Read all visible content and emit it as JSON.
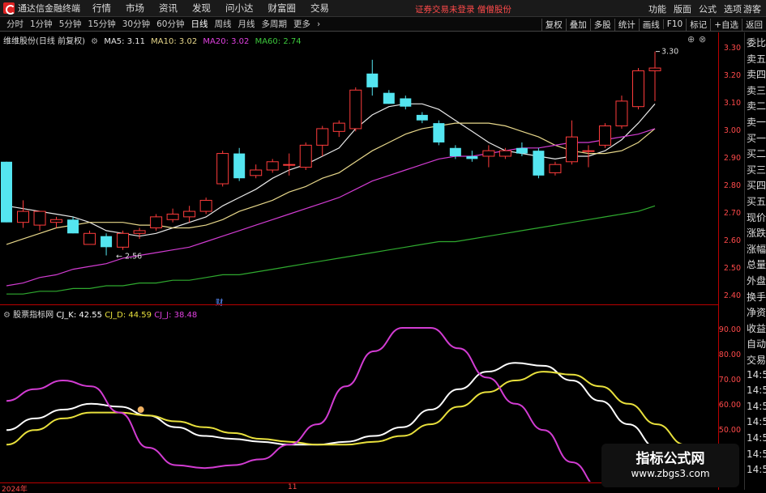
{
  "menubar": {
    "app_title": "通达信金融终端",
    "items": [
      "行情",
      "市场",
      "资讯",
      "发现",
      "问小达",
      "财富圈",
      "交易"
    ],
    "notice": "证券交易未登录  僧僧股份",
    "right_items": [
      "功能",
      "版面",
      "公式",
      "选项"
    ],
    "guest": "游客"
  },
  "toolbar": {
    "periods": [
      "分时",
      "1分钟",
      "5分钟",
      "15分钟",
      "30分钟",
      "60分钟",
      "日线",
      "周线",
      "月线",
      "多周期",
      "更多"
    ],
    "active_period": "日线",
    "right_items": [
      "复权",
      "叠加",
      "多股",
      "统计",
      "画线",
      "F10",
      "标记",
      "+自选",
      "返回"
    ]
  },
  "main_chart": {
    "stock_label": "维维股份(日线 前复权)",
    "ma": [
      {
        "name": "MA5: 3.11",
        "color": "#e8e8e8"
      },
      {
        "name": "MA10: 3.02",
        "color": "#e7d78a"
      },
      {
        "name": "MA20: 3.02",
        "color": "#e040e0"
      },
      {
        "name": "MA60: 2.74",
        "color": "#3cc83c"
      }
    ],
    "high_label": "3.30",
    "low_label": "2.56",
    "cai_label": "财",
    "y_ticks": [
      "3.30",
      "3.20",
      "3.10",
      "3.00",
      "2.90",
      "2.80",
      "2.70",
      "2.60",
      "2.50",
      "2.40"
    ]
  },
  "sub_chart": {
    "indicator_label": "股票指标网",
    "lines": [
      {
        "name": "CJ_K: 42.55",
        "color": "#ffffff"
      },
      {
        "name": "CJ_D: 44.59",
        "color": "#e8e03c"
      },
      {
        "name": "CJ_J: 38.48",
        "color": "#e040e0"
      }
    ],
    "y_ticks": [
      "90.00",
      "80.00",
      "70.00",
      "60.00",
      "50.00"
    ]
  },
  "xaxis": {
    "labels": [
      "2024年",
      "11"
    ]
  },
  "side_panel": {
    "items": [
      "委比",
      "卖五",
      "卖四",
      "卖三",
      "卖二",
      "卖一",
      "买一",
      "买二",
      "买三",
      "买四",
      "买五",
      "现价",
      "涨跌",
      "涨幅",
      "总量",
      "外盘",
      "换手",
      "净资",
      "收益",
      "自动",
      "交易",
      "14:5",
      "14:5",
      "14:5",
      "14:5",
      "14:5",
      "14:5",
      "14:5"
    ]
  },
  "watermark": {
    "line1": "指标公式网",
    "line2": "www.zbgs3.com"
  },
  "chart_data": [
    {
      "type": "candlestick",
      "ylim": [
        2.4,
        3.34
      ],
      "candles": [
        {
          "o": 2.9,
          "h": 2.9,
          "l": 2.68,
          "c": 2.68
        },
        {
          "o": 2.68,
          "h": 2.76,
          "l": 2.66,
          "c": 2.72
        },
        {
          "o": 2.67,
          "h": 2.72,
          "l": 2.65,
          "c": 2.72
        },
        {
          "o": 2.68,
          "h": 2.7,
          "l": 2.66,
          "c": 2.69
        },
        {
          "o": 2.69,
          "h": 2.7,
          "l": 2.64,
          "c": 2.64
        },
        {
          "o": 2.6,
          "h": 2.65,
          "l": 2.6,
          "c": 2.64
        },
        {
          "o": 2.63,
          "h": 2.64,
          "l": 2.56,
          "c": 2.59
        },
        {
          "o": 2.59,
          "h": 2.65,
          "l": 2.58,
          "c": 2.64
        },
        {
          "o": 2.64,
          "h": 2.66,
          "l": 2.62,
          "c": 2.65
        },
        {
          "o": 2.66,
          "h": 2.71,
          "l": 2.65,
          "c": 2.7
        },
        {
          "o": 2.69,
          "h": 2.73,
          "l": 2.68,
          "c": 2.71
        },
        {
          "o": 2.7,
          "h": 2.74,
          "l": 2.68,
          "c": 2.72
        },
        {
          "o": 2.72,
          "h": 2.77,
          "l": 2.71,
          "c": 2.76
        },
        {
          "o": 2.82,
          "h": 2.94,
          "l": 2.81,
          "c": 2.93
        },
        {
          "o": 2.93,
          "h": 2.95,
          "l": 2.83,
          "c": 2.84
        },
        {
          "o": 2.85,
          "h": 2.89,
          "l": 2.84,
          "c": 2.87
        },
        {
          "o": 2.87,
          "h": 2.91,
          "l": 2.86,
          "c": 2.9
        },
        {
          "o": 2.89,
          "h": 2.93,
          "l": 2.85,
          "c": 2.89
        },
        {
          "o": 2.88,
          "h": 2.97,
          "l": 2.87,
          "c": 2.96
        },
        {
          "o": 2.96,
          "h": 3.03,
          "l": 2.92,
          "c": 3.02
        },
        {
          "o": 3.01,
          "h": 3.05,
          "l": 2.99,
          "c": 3.04
        },
        {
          "o": 3.02,
          "h": 3.17,
          "l": 3.01,
          "c": 3.16
        },
        {
          "o": 3.22,
          "h": 3.27,
          "l": 3.14,
          "c": 3.17
        },
        {
          "o": 3.15,
          "h": 3.16,
          "l": 3.11,
          "c": 3.11
        },
        {
          "o": 3.13,
          "h": 3.14,
          "l": 3.09,
          "c": 3.1
        },
        {
          "o": 3.07,
          "h": 3.08,
          "l": 3.04,
          "c": 3.05
        },
        {
          "o": 3.04,
          "h": 3.05,
          "l": 2.96,
          "c": 2.97
        },
        {
          "o": 2.95,
          "h": 2.96,
          "l": 2.91,
          "c": 2.92
        },
        {
          "o": 2.92,
          "h": 2.94,
          "l": 2.9,
          "c": 2.91
        },
        {
          "o": 2.92,
          "h": 2.96,
          "l": 2.88,
          "c": 2.94
        },
        {
          "o": 2.92,
          "h": 2.95,
          "l": 2.91,
          "c": 2.94
        },
        {
          "o": 2.95,
          "h": 2.97,
          "l": 2.92,
          "c": 2.93
        },
        {
          "o": 2.94,
          "h": 2.95,
          "l": 2.84,
          "c": 2.85
        },
        {
          "o": 2.86,
          "h": 2.9,
          "l": 2.85,
          "c": 2.89
        },
        {
          "o": 2.9,
          "h": 3.05,
          "l": 2.89,
          "c": 2.99
        },
        {
          "o": 2.94,
          "h": 2.96,
          "l": 2.88,
          "c": 2.94
        },
        {
          "o": 2.96,
          "h": 3.04,
          "l": 2.95,
          "c": 3.03
        },
        {
          "o": 3.03,
          "h": 3.14,
          "l": 3.02,
          "c": 3.12
        },
        {
          "o": 3.1,
          "h": 3.24,
          "l": 3.09,
          "c": 3.23
        },
        {
          "o": 3.23,
          "h": 3.3,
          "l": 3.12,
          "c": 3.24
        }
      ],
      "series": [
        {
          "name": "MA5",
          "values": [
            2.74,
            2.73,
            2.72,
            2.71,
            2.7,
            2.68,
            2.65,
            2.64,
            2.63,
            2.64,
            2.66,
            2.68,
            2.7,
            2.74,
            2.77,
            2.8,
            2.84,
            2.87,
            2.89,
            2.92,
            2.95,
            3.02,
            3.07,
            3.1,
            3.11,
            3.11,
            3.09,
            3.05,
            3.01,
            2.97,
            2.94,
            2.93,
            2.92,
            2.91,
            2.92,
            2.92,
            2.94,
            2.98,
            3.04,
            3.11
          ]
        },
        {
          "name": "MA10",
          "values": [
            2.6,
            2.62,
            2.64,
            2.66,
            2.67,
            2.68,
            2.68,
            2.68,
            2.67,
            2.67,
            2.66,
            2.66,
            2.67,
            2.69,
            2.72,
            2.74,
            2.76,
            2.79,
            2.81,
            2.84,
            2.86,
            2.9,
            2.94,
            2.97,
            3.0,
            3.02,
            3.03,
            3.04,
            3.04,
            3.04,
            3.03,
            3.01,
            2.99,
            2.96,
            2.94,
            2.93,
            2.93,
            2.94,
            2.97,
            3.02
          ]
        },
        {
          "name": "MA20",
          "values": [
            2.45,
            2.46,
            2.48,
            2.49,
            2.51,
            2.52,
            2.53,
            2.55,
            2.56,
            2.57,
            2.58,
            2.59,
            2.61,
            2.63,
            2.65,
            2.67,
            2.69,
            2.71,
            2.73,
            2.75,
            2.77,
            2.8,
            2.83,
            2.85,
            2.87,
            2.89,
            2.91,
            2.92,
            2.92,
            2.93,
            2.94,
            2.95,
            2.95,
            2.96,
            2.97,
            2.97,
            2.98,
            2.99,
            3.0,
            3.02
          ]
        },
        {
          "name": "MA60",
          "values": [
            2.42,
            2.42,
            2.43,
            2.43,
            2.44,
            2.44,
            2.45,
            2.45,
            2.46,
            2.46,
            2.47,
            2.47,
            2.48,
            2.49,
            2.49,
            2.5,
            2.51,
            2.52,
            2.53,
            2.54,
            2.55,
            2.56,
            2.57,
            2.58,
            2.59,
            2.6,
            2.61,
            2.61,
            2.62,
            2.63,
            2.64,
            2.65,
            2.66,
            2.67,
            2.68,
            2.69,
            2.7,
            2.71,
            2.72,
            2.74
          ]
        }
      ]
    },
    {
      "type": "line",
      "ylim": [
        42,
        98
      ],
      "series": [
        {
          "name": "CJ_K",
          "values": [
            58,
            62,
            65,
            67,
            66,
            63,
            59,
            56,
            55,
            54,
            53,
            53,
            54,
            56,
            59,
            65,
            72,
            78,
            81,
            80,
            75,
            68,
            60,
            52,
            46,
            42
          ]
        },
        {
          "name": "CJ_D",
          "values": [
            53,
            58,
            62,
            64,
            64,
            63,
            61,
            59,
            57,
            55,
            54,
            53,
            53,
            54,
            56,
            60,
            66,
            71,
            75,
            78,
            77,
            73,
            67,
            60,
            53,
            48
          ]
        },
        {
          "name": "CJ_J",
          "values": [
            68,
            72,
            75,
            73,
            64,
            52,
            46,
            45,
            46,
            48,
            53,
            60,
            73,
            85,
            93,
            93,
            86,
            76,
            67,
            58,
            47,
            38,
            35,
            33,
            32,
            32
          ]
        }
      ]
    }
  ]
}
